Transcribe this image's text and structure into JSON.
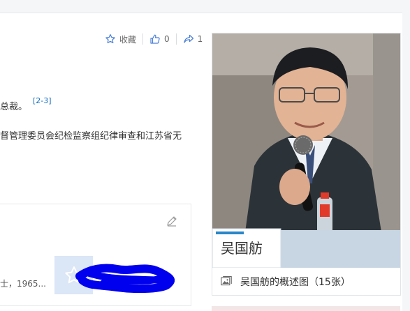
{
  "actions": {
    "collect_label": "收藏",
    "like_count": "0",
    "share_count": "1"
  },
  "text": {
    "line1": "总裁。",
    "ref": "[2-3]",
    "line2": "督管理委员会纪检监察组纪律审查和江苏省无"
  },
  "card": {
    "snippet": "士，1965..."
  },
  "photo": {
    "nameplate": "吴国舫",
    "caption": "吴国舫的概述图（15张）"
  },
  "colors": {
    "link": "#136ec2",
    "scribble": "#0000ee",
    "thumb_bg": "#dbe6f6"
  }
}
